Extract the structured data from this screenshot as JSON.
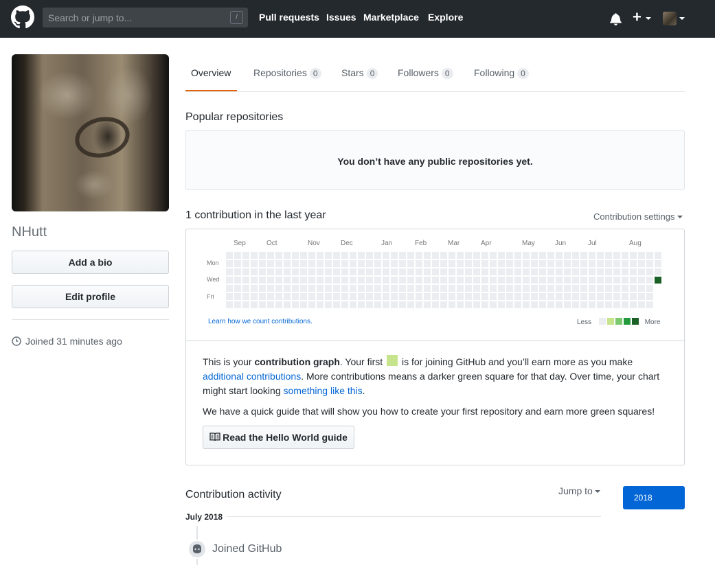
{
  "header": {
    "search_placeholder": "Search or jump to...",
    "search_shortcut": "/",
    "nav": [
      "Pull requests",
      "Issues",
      "Marketplace",
      "Explore"
    ]
  },
  "profile": {
    "username": "NHutt",
    "add_bio_label": "Add a bio",
    "edit_profile_label": "Edit profile",
    "joined_text": "Joined 31 minutes ago"
  },
  "tabs": [
    {
      "label": "Overview"
    },
    {
      "label": "Repositories",
      "count": "0"
    },
    {
      "label": "Stars",
      "count": "0"
    },
    {
      "label": "Followers",
      "count": "0"
    },
    {
      "label": "Following",
      "count": "0"
    }
  ],
  "popular": {
    "title": "Popular repositories",
    "empty_text": "You don’t have any public repositories yet."
  },
  "contributions": {
    "title": "1 contribution in the last year",
    "settings_label": "Contribution settings",
    "months": [
      "Sep",
      "Oct",
      "Nov",
      "Dec",
      "Jan",
      "Feb",
      "Mar",
      "Apr",
      "May",
      "Jun",
      "Jul",
      "Aug"
    ],
    "day_labels": [
      "Mon",
      "Wed",
      "Fri"
    ],
    "learn_link": "Learn how we count contributions.",
    "legend_less": "Less",
    "legend_more": "More",
    "colors": {
      "empty": "#ebedf0",
      "l1": "#c6e48b",
      "l2": "#7bc96f",
      "l3": "#239a3b",
      "l4": "#196127"
    },
    "weeks": 53,
    "active_cell": {
      "week": 52,
      "day": 3,
      "level": 4
    }
  },
  "blankslate": {
    "t1": "This is your ",
    "t1b": "contribution graph",
    "t2": ". Your first ",
    "t3": " is for joining GitHub and you’ll earn more as you make ",
    "link1": "additional contributions",
    "t4": ". More contributions means a darker green square for that day. Over time, your chart might start looking ",
    "link2": "something like this",
    "t5": ".",
    "guide_text": "We have a quick guide that will show you how to create your first repository and earn more green squares!",
    "guide_button": "Read the Hello World guide"
  },
  "activity": {
    "title": "Contribution activity",
    "jump_to": "Jump to",
    "year": "2018",
    "month": "July 2018",
    "event": "Joined GitHub"
  }
}
